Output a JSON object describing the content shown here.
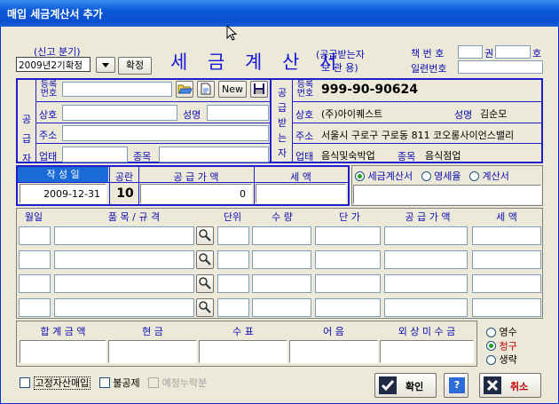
{
  "window": {
    "title": "매입 세금계산서 추가"
  },
  "report_period": {
    "label": "(신고 분기)",
    "value": "2009년2기확정",
    "confirm_label": "확정"
  },
  "heading": {
    "title": "세 금 계 산 서",
    "holder_line1": "(공급받는자",
    "holder_line2": "보  관  용)"
  },
  "book": {
    "volume_label": "책 번 호",
    "kwon": "권",
    "ho": "호",
    "serial_label": "일련번호"
  },
  "supplier": {
    "side_label": [
      "공",
      "급",
      "자"
    ],
    "reg_no_label": "등록번호",
    "company_label": "상호",
    "name_label": "성명",
    "address_label": "주소",
    "business_label": "업태",
    "item_label": "종목",
    "new_label": "New",
    "reg_no": "",
    "company": "",
    "name": "",
    "address": "",
    "business": "",
    "item": ""
  },
  "buyer": {
    "side_label": [
      "공",
      "급",
      "받",
      "는",
      "자"
    ],
    "reg_no_label": "등록번호",
    "company_label": "상호",
    "name_label": "성명",
    "address_label": "주소",
    "business_label": "업태",
    "item_label": "종목",
    "reg_no": "999-90-90624",
    "company": "(주)아이퀘스트",
    "name": "김순모",
    "address": "서울시 구로구 구로동 811 코오롱사이언스밸리",
    "business": "음식및숙박업",
    "item": "음식점업"
  },
  "summary": {
    "date_label": "작 성 일",
    "blank_label": "공란",
    "supply_label": "공 급 가 액",
    "tax_label": "세    액",
    "date": "2009-12-31",
    "blank_count": "10",
    "supply_value": "0",
    "tax_value": ""
  },
  "invoice_type": {
    "options": [
      "세금계산서",
      "영세율",
      "계산서"
    ],
    "selected": "세금계산서"
  },
  "items_header": [
    "월일",
    "품 목 / 규 격",
    "단위",
    "수  량",
    "단  가",
    "공 급 가 액",
    "세    액"
  ],
  "items_rows": [
    [
      "",
      "",
      "",
      "",
      "",
      "",
      ""
    ],
    [
      "",
      "",
      "",
      "",
      "",
      "",
      ""
    ],
    [
      "",
      "",
      "",
      "",
      "",
      "",
      ""
    ],
    [
      "",
      "",
      "",
      "",
      "",
      "",
      ""
    ]
  ],
  "totals": {
    "headers": [
      "합 계 금 액",
      "현    금",
      "수    표",
      "어    음",
      "외 상 미 수 금"
    ],
    "values": [
      "",
      "",
      "",
      "",
      ""
    ]
  },
  "receipt_type": {
    "options": [
      "영수",
      "청구",
      "생략"
    ],
    "selected": "청구"
  },
  "footer": {
    "fixed_asset": "고정자산매입",
    "non_deduct": "불공제",
    "omitted": "예정누락분",
    "ok_label": "확인",
    "help_label": "?",
    "cancel_label": "취소"
  },
  "colors": {
    "title_bar": "#0a58d8",
    "form_border": "#1e1ecf",
    "label_text": "#0b0bb5",
    "selected_red": "#c00000"
  }
}
